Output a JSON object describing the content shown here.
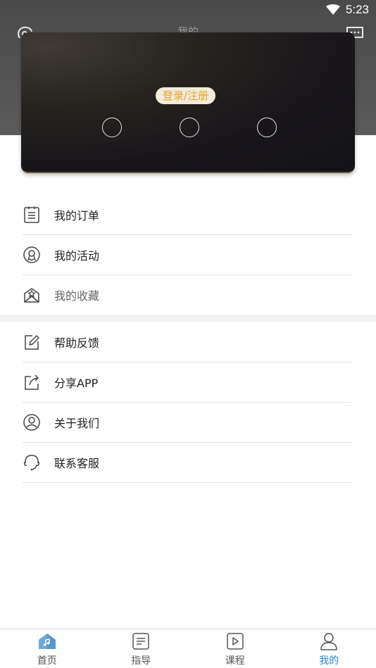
{
  "status_bar": {
    "time": "5:23"
  },
  "header": {
    "title": "我的"
  },
  "card": {
    "login_label": "登录/注册"
  },
  "menu": {
    "items": [
      {
        "label": "我的订单",
        "icon": "order-list-icon"
      },
      {
        "label": "我的活动",
        "icon": "activity-badge-icon"
      },
      {
        "label": "我的收藏",
        "icon": "favorites-box-icon"
      },
      {
        "label": "帮助反馈",
        "icon": "edit-feedback-icon"
      },
      {
        "label": "分享APP",
        "icon": "share-icon"
      },
      {
        "label": "关于我们",
        "icon": "user-circle-icon"
      },
      {
        "label": "联系客服",
        "icon": "headset-icon"
      }
    ]
  },
  "tabbar": {
    "tabs": [
      {
        "label": "首页",
        "icon": "home-icon"
      },
      {
        "label": "指导",
        "icon": "guide-doc-icon"
      },
      {
        "label": "课程",
        "icon": "course-play-icon"
      },
      {
        "label": "我的",
        "icon": "profile-icon",
        "active": true
      }
    ]
  },
  "colors": {
    "accent": "#2b84c8",
    "login_text": "#e8a326",
    "header_bg": "#4a4a4a"
  }
}
